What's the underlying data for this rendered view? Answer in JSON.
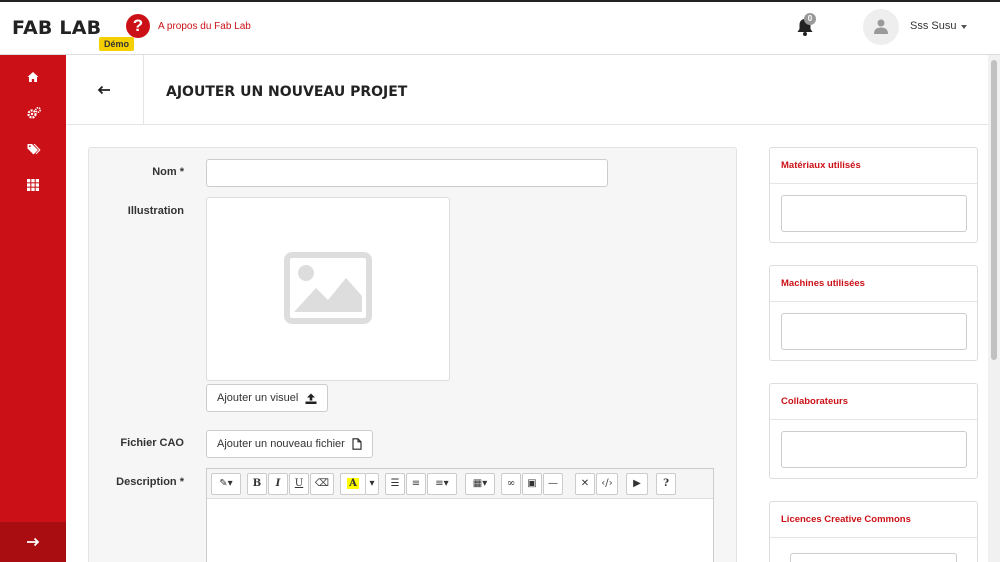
{
  "header": {
    "logo": "FAB LAB",
    "about_link": "A propos du Fab Lab",
    "badge": "Démo",
    "notification_count": "0",
    "user_name": "Sss Susu"
  },
  "sidebar": {
    "items": [
      {
        "icon": "home-icon"
      },
      {
        "icon": "gears-icon"
      },
      {
        "icon": "tags-icon"
      },
      {
        "icon": "grid-icon"
      }
    ],
    "bottom_icon": "arrow-right-icon"
  },
  "page": {
    "title": "AJOUTER UN NOUVEAU PROJET"
  },
  "form": {
    "name_label": "Nom *",
    "name_value": "",
    "illustration_label": "Illustration",
    "add_visual_button": "Ajouter un visuel",
    "cao_label": "Fichier CAO",
    "add_file_button": "Ajouter un nouveau fichier",
    "description_label": "Description *",
    "toolbar": [
      "magic",
      "B",
      "I",
      "U",
      "eraser",
      "A",
      "ul",
      "ol",
      "align",
      "table",
      "link",
      "image",
      "hr",
      "fullscreen",
      "code",
      "video",
      "?"
    ]
  },
  "side_panels": [
    {
      "title": "Matériaux utilisés"
    },
    {
      "title": "Machines utilisées"
    },
    {
      "title": "Collaborateurs"
    },
    {
      "title": "Licences Creative Commons"
    }
  ],
  "colors": {
    "brand": "#cb1117",
    "badge": "#f5d000"
  }
}
